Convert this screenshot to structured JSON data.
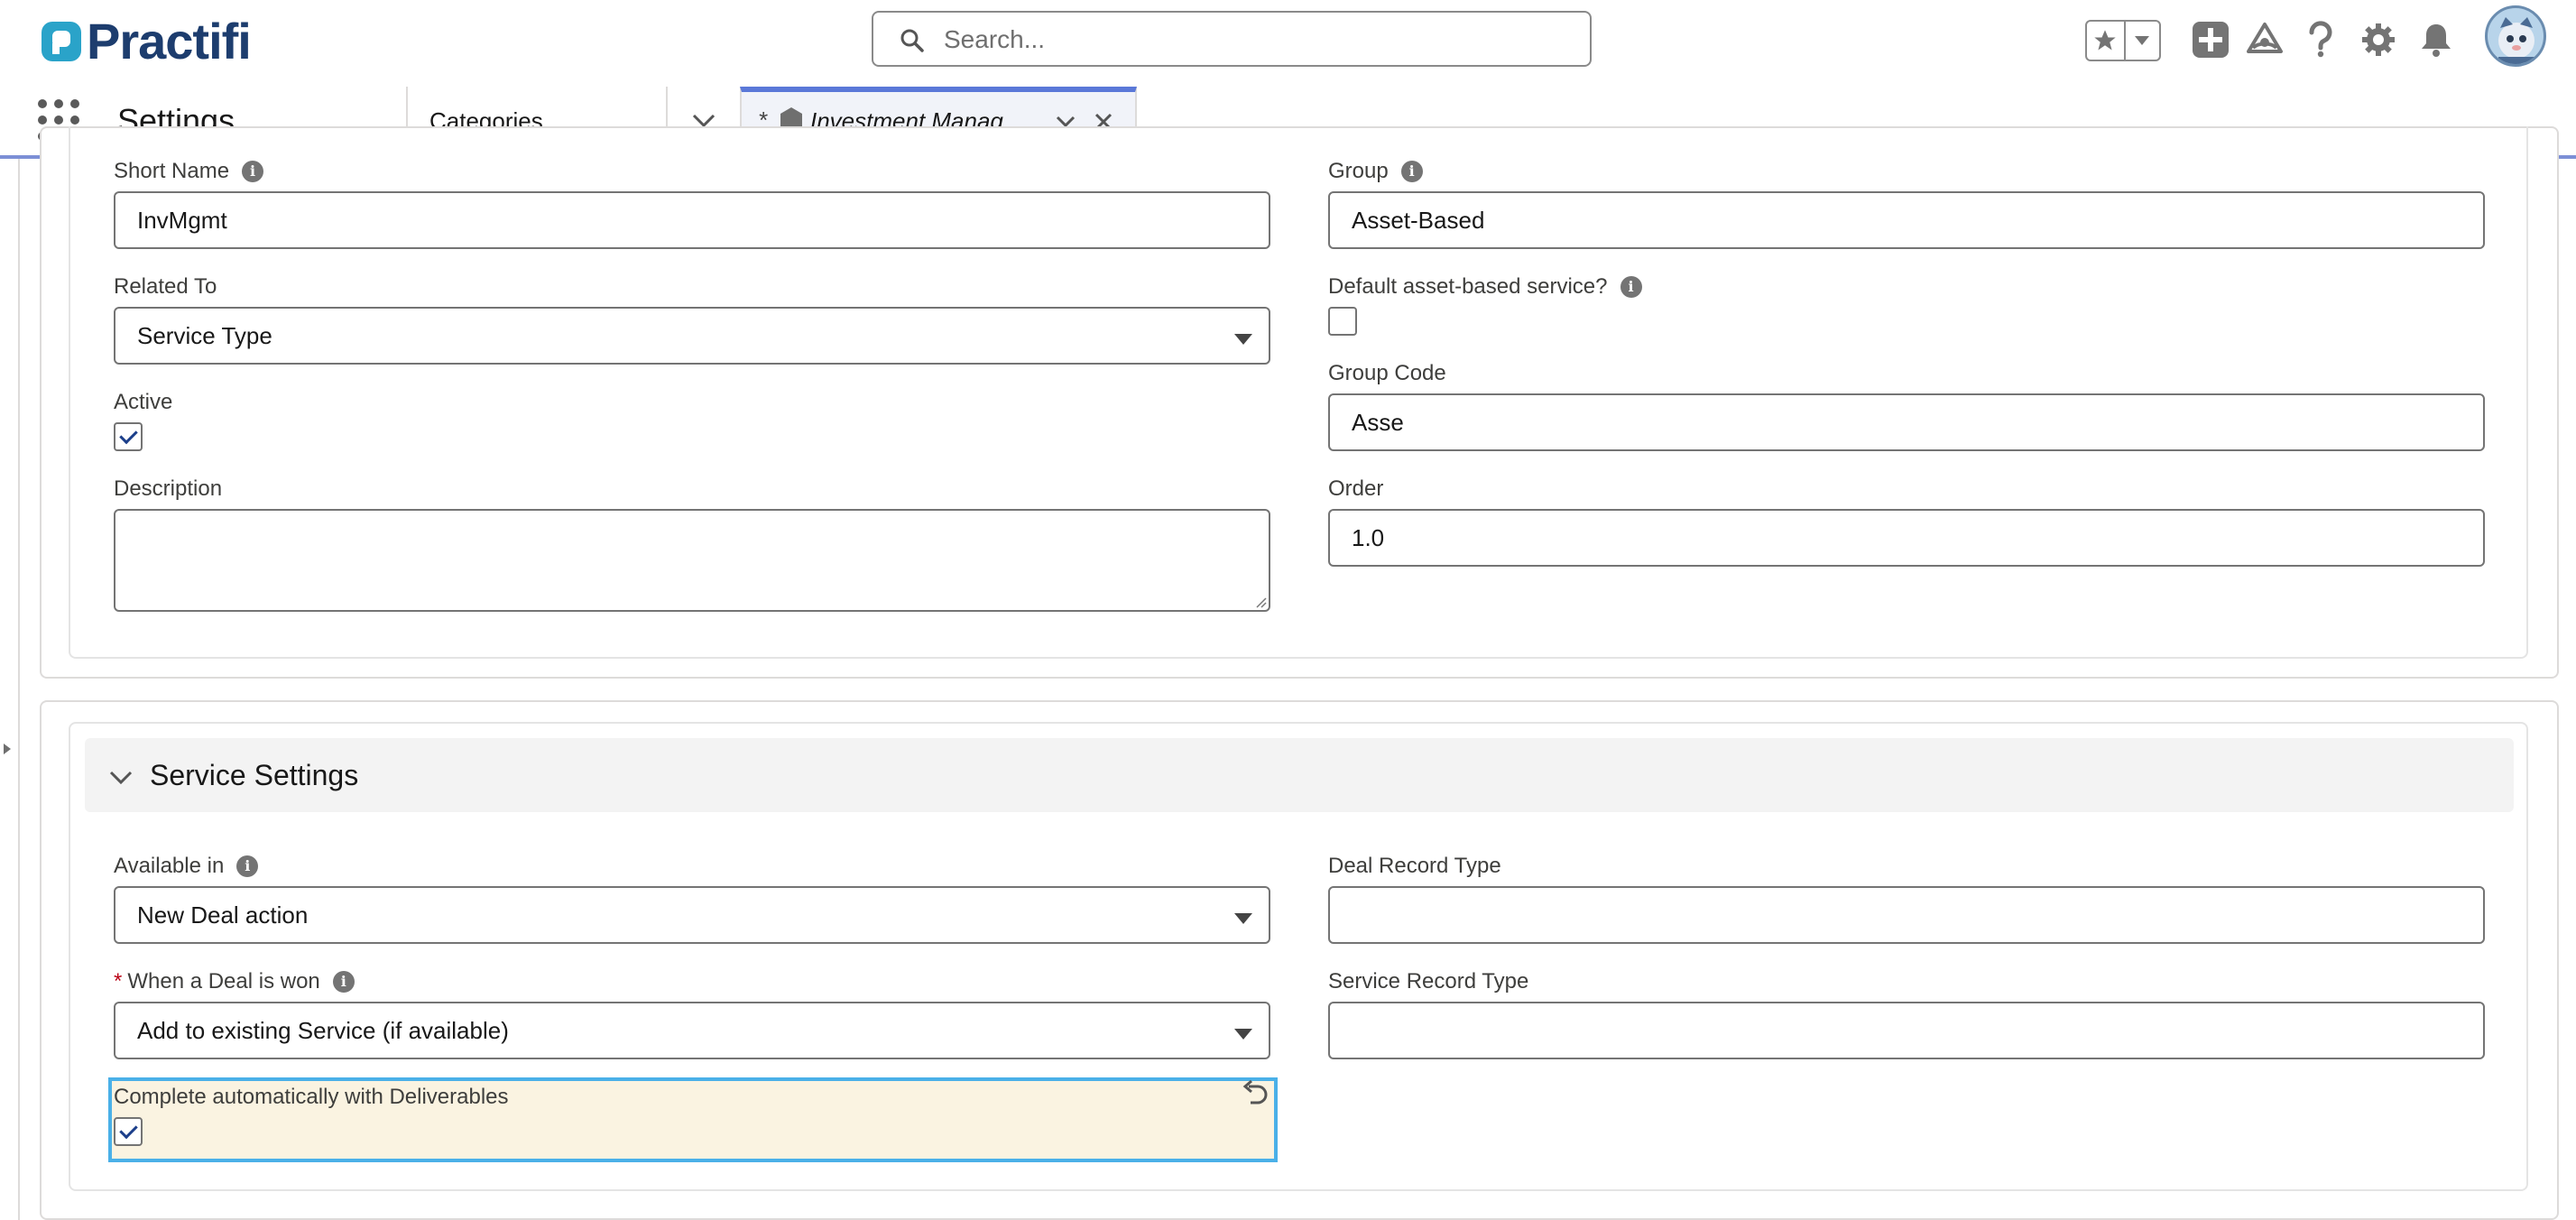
{
  "header": {
    "brand": "Practifi",
    "search_placeholder": "Search...",
    "icons": [
      "favorites-star-icon",
      "favorites-menu-icon",
      "global-actions-plus-icon",
      "trailhead-icon",
      "help-icon",
      "setup-gear-icon",
      "notifications-bell-icon",
      "avatar"
    ]
  },
  "nav": {
    "app_name": "Settings",
    "object_tab": "Categories",
    "record_tab": {
      "dirty_marker": "*",
      "label": "Investment Manag..."
    }
  },
  "details": {
    "short_name": {
      "label": "Short Name",
      "value": "InvMgmt"
    },
    "group": {
      "label": "Group",
      "value": "Asset-Based"
    },
    "related_to": {
      "label": "Related To",
      "value": "Service Type"
    },
    "default_asset_based": {
      "label": "Default asset-based service?",
      "checked": false
    },
    "active": {
      "label": "Active",
      "checked": true
    },
    "group_code": {
      "label": "Group Code",
      "value": "Asse"
    },
    "description": {
      "label": "Description",
      "value": ""
    },
    "order": {
      "label": "Order",
      "value": "1.0"
    }
  },
  "service_settings": {
    "title": "Service Settings",
    "available_in": {
      "label": "Available in",
      "value": "New Deal action"
    },
    "deal_record_type": {
      "label": "Deal Record Type",
      "value": ""
    },
    "when_deal_won": {
      "required_marker": "*",
      "label": "When a Deal is won",
      "value": "Add to existing Service (if available)"
    },
    "service_record_type": {
      "label": "Service Record Type",
      "value": ""
    },
    "complete_automatically": {
      "label": "Complete automatically with Deliverables",
      "checked": true
    }
  },
  "colors": {
    "brand": "#1d3d6e",
    "tab_accent": "#5a78d8",
    "edited_highlight_bg": "#faf3e1",
    "edited_highlight_border": "#4ab0e8",
    "required": "#ba0517",
    "checkmark": "#1b3e8a"
  }
}
